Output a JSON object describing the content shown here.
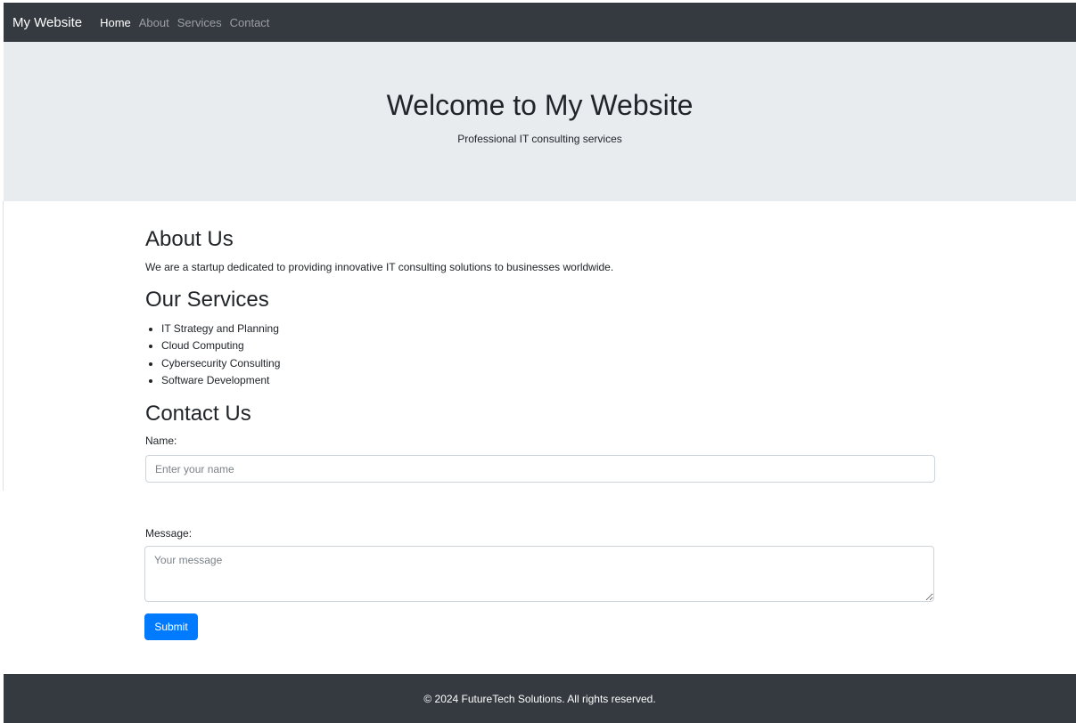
{
  "nav": {
    "brand": "My Website",
    "links": [
      {
        "label": "Home",
        "active": true
      },
      {
        "label": "About",
        "active": false
      },
      {
        "label": "Services",
        "active": false
      },
      {
        "label": "Contact",
        "active": false
      }
    ]
  },
  "hero": {
    "title": "Welcome to My Website",
    "subtitle": "Professional IT consulting services"
  },
  "about": {
    "title": "About Us",
    "text": "We are a startup dedicated to providing innovative IT consulting solutions to businesses worldwide."
  },
  "services": {
    "title": "Our Services",
    "items": [
      "IT Strategy and Planning",
      "Cloud Computing",
      "Cybersecurity Consulting",
      "Software Development"
    ]
  },
  "contact": {
    "title": "Contact Us",
    "name_label": "Name:",
    "name_placeholder": "Enter your name",
    "message_label": "Message:",
    "message_placeholder": "Your message",
    "submit_label": "Submit"
  },
  "footer": {
    "text": "© 2024 FutureTech Solutions. All rights reserved."
  },
  "colors": {
    "navbar_bg": "#343a40",
    "hero_bg": "#e9ecef",
    "button_bg": "#007bff",
    "footer_bg": "#343a40"
  }
}
